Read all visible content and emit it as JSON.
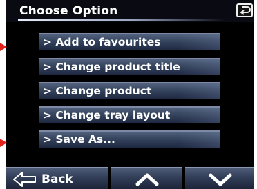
{
  "header": {
    "title": "Choose Option",
    "return_icon": "return-arrow-icon"
  },
  "menu": {
    "items": [
      {
        "label": "> Add to favourites"
      },
      {
        "label": "> Change product title"
      },
      {
        "label": "> Change product"
      },
      {
        "label": "> Change tray layout"
      },
      {
        "label": "> Save As..."
      }
    ]
  },
  "footer": {
    "back_label": "Back",
    "back_icon": "back-arrow-icon",
    "up_icon": "chevron-up-icon",
    "down_icon": "chevron-down-icon"
  },
  "colors": {
    "accent_pointer": "#e0231b",
    "button_fill": "#3a4962",
    "text": "#ffffff"
  }
}
